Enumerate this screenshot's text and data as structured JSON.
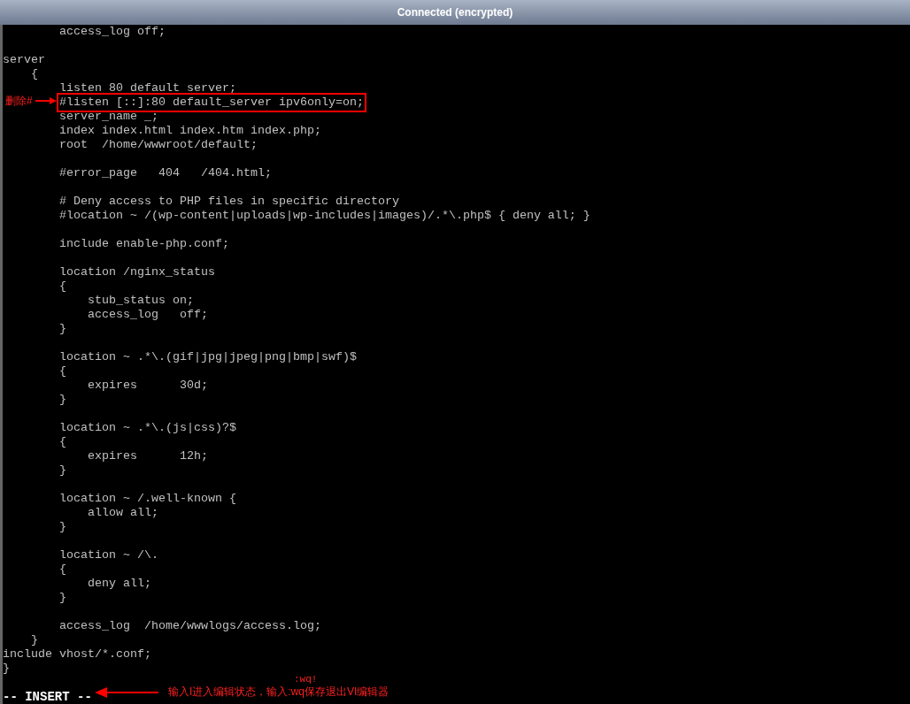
{
  "window": {
    "title": "Connected (encrypted)"
  },
  "editor": {
    "blocks": [
      [
        {
          "text": "        access_log off;",
          "marked": false
        }
      ],
      [
        {
          "text": "server",
          "marked": false
        },
        {
          "text": "    {",
          "marked": false
        },
        {
          "text": "        listen 80 default server;",
          "marked": false
        },
        {
          "text": "        #listen [::]:80 default_server ipv6only=on;",
          "marked": true
        },
        {
          "text": "        server_name _;",
          "marked": false
        },
        {
          "text": "        index index.html index.htm index.php;",
          "marked": false
        },
        {
          "text": "        root  /home/wwwroot/default;",
          "marked": false
        }
      ],
      [
        {
          "text": "        #error_page   404   /404.html;",
          "marked": false
        }
      ],
      [
        {
          "text": "        # Deny access to PHP files in specific directory",
          "marked": false
        },
        {
          "text": "        #location ~ /(wp-content|uploads|wp-includes|images)/.*\\.php$ { deny all; }",
          "marked": false
        }
      ],
      [
        {
          "text": "        include enable-php.conf;",
          "marked": false
        }
      ],
      [
        {
          "text": "        location /nginx_status",
          "marked": false
        },
        {
          "text": "        {",
          "marked": false
        },
        {
          "text": "            stub_status on;",
          "marked": false
        },
        {
          "text": "            access_log   off;",
          "marked": false
        },
        {
          "text": "        }",
          "marked": false
        }
      ],
      [
        {
          "text": "        location ~ .*\\.(gif|jpg|jpeg|png|bmp|swf)$",
          "marked": false
        },
        {
          "text": "        {",
          "marked": false
        },
        {
          "text": "            expires      30d;",
          "marked": false
        },
        {
          "text": "        }",
          "marked": false
        }
      ],
      [
        {
          "text": "        location ~ .*\\.(js|css)?$",
          "marked": false
        },
        {
          "text": "        {",
          "marked": false
        },
        {
          "text": "            expires      12h;",
          "marked": false
        },
        {
          "text": "        }",
          "marked": false
        }
      ],
      [
        {
          "text": "        location ~ /.well-known {",
          "marked": false
        },
        {
          "text": "            allow all;",
          "marked": false
        },
        {
          "text": "        }",
          "marked": false
        }
      ],
      [
        {
          "text": "        location ~ /\\.",
          "marked": false
        },
        {
          "text": "        {",
          "marked": false
        },
        {
          "text": "            deny all;",
          "marked": false
        },
        {
          "text": "        }",
          "marked": false
        }
      ],
      [
        {
          "text": "        access_log  /home/wwwlogs/access.log;",
          "marked": false
        },
        {
          "text": "    }",
          "marked": false
        },
        {
          "text": "include vhost/*.conf;",
          "marked": false
        },
        {
          "text": "}",
          "marked": false
        }
      ]
    ],
    "status_line": "-- INSERT --"
  },
  "annotations": {
    "delete_label": "删除#",
    "instruction": "输入I进入编辑状态，输入:wq保存退出VI编辑器",
    "command_hint": ":wq!"
  }
}
